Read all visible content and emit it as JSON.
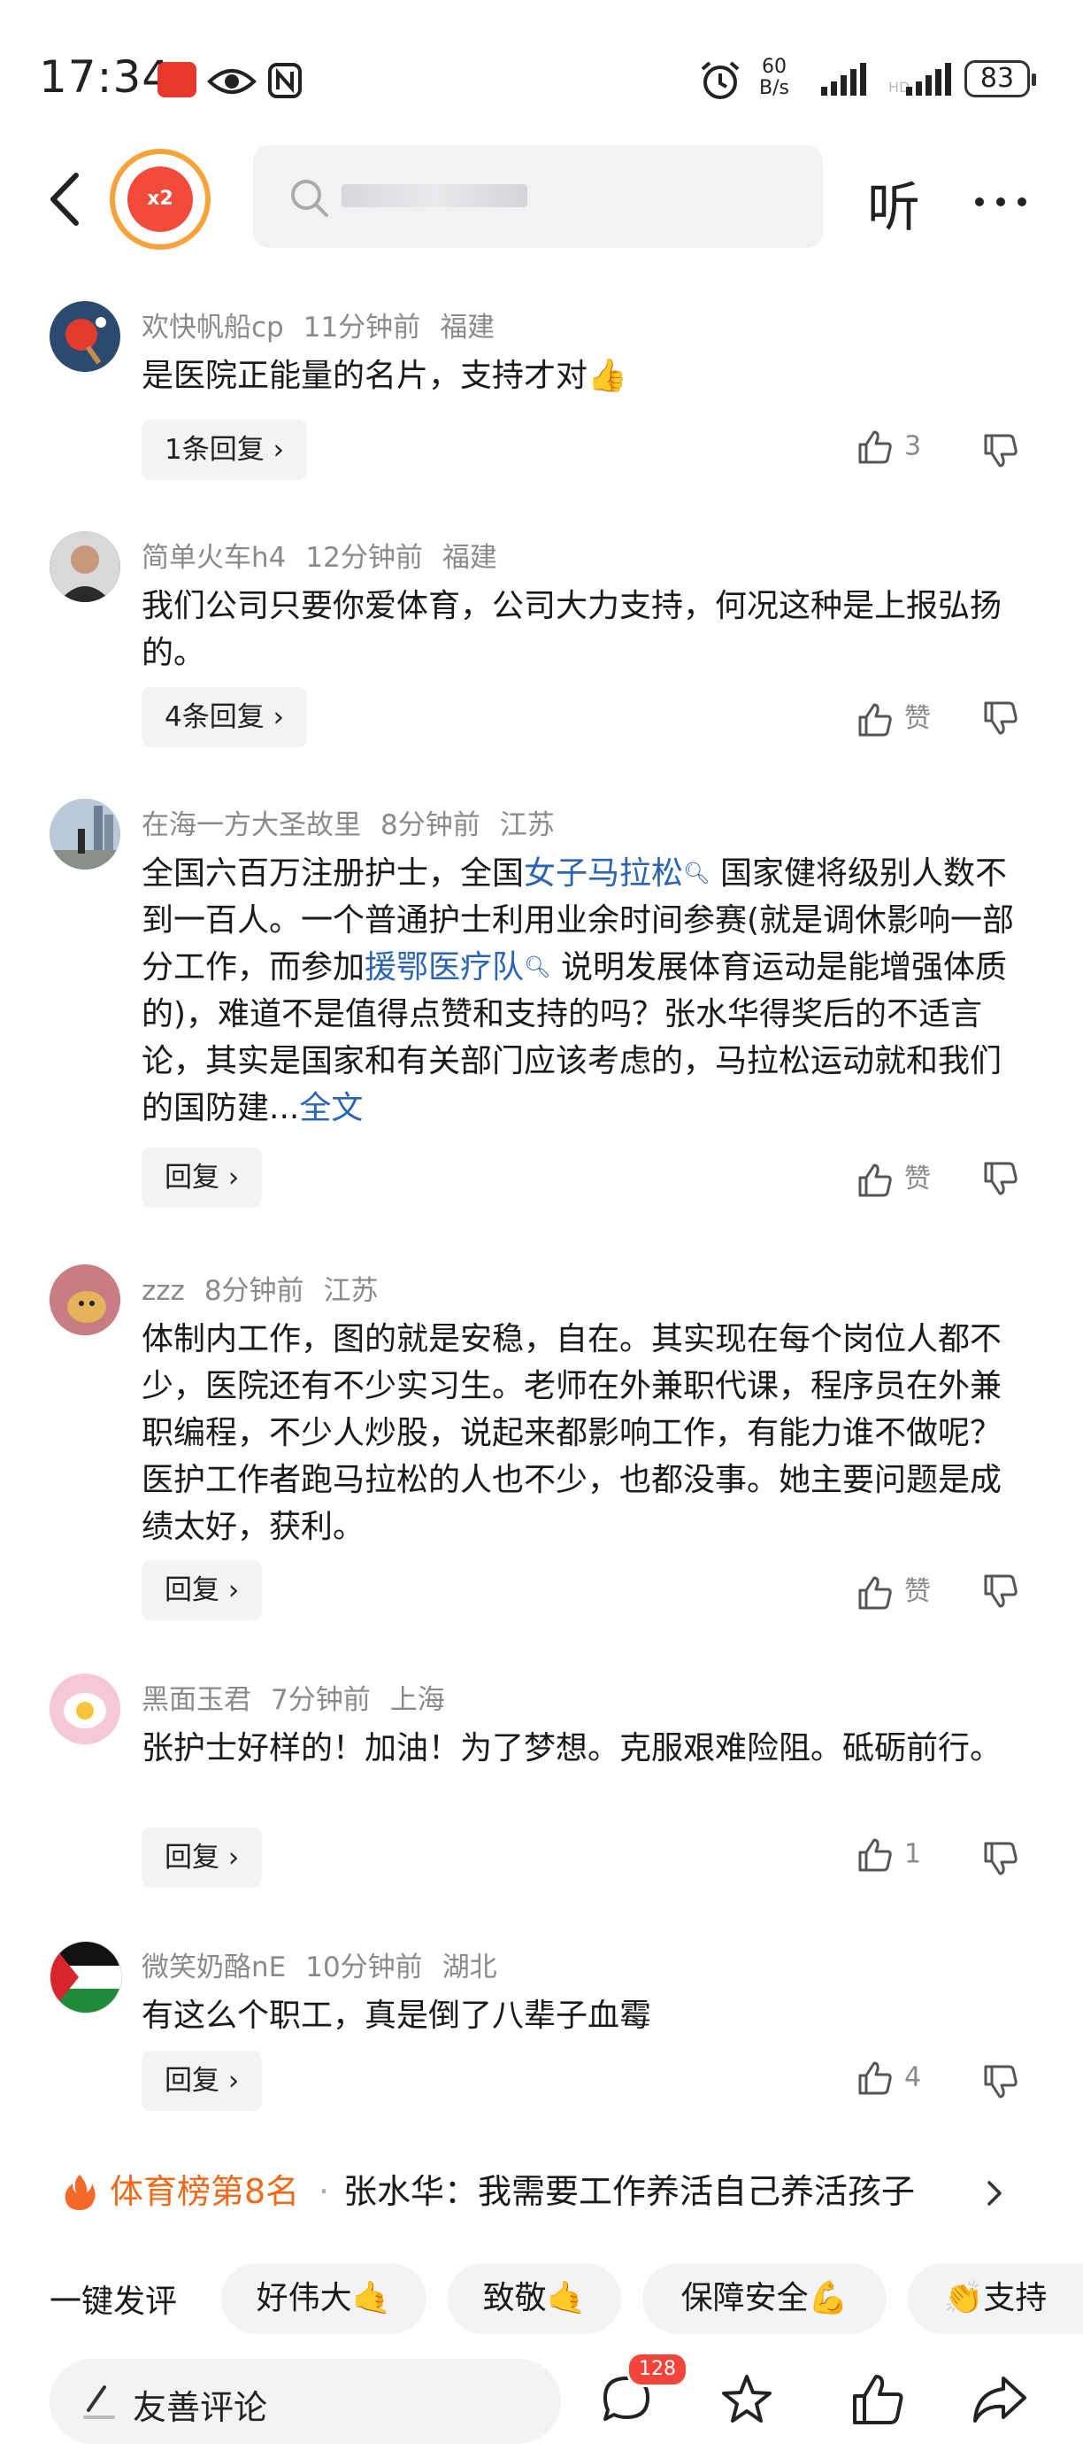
{
  "status_bar": {
    "time": "17:34",
    "network_speed_value": "60",
    "network_speed_unit": "B/s",
    "battery": "83",
    "icons": [
      "huawei-app-icon",
      "eye-icon",
      "nfc-icon",
      "alarm-icon",
      "signal-icon",
      "signal-icon"
    ]
  },
  "header": {
    "red_packet_label": "x2",
    "search_placeholder": "",
    "listen_label": "听",
    "icons": [
      "back-icon",
      "search-icon",
      "more-icon"
    ]
  },
  "comments": [
    {
      "user": "欢快帆船cp",
      "time": "11分钟前",
      "location": "福建",
      "text": "是医院正能量的名片，支持才对👍",
      "reply_label": "1条回复",
      "likes": "3"
    },
    {
      "user": "简单火车h4",
      "time": "12分钟前",
      "location": "福建",
      "text": "我们公司只要你爱体育，公司大力支持，何况这种是上报弘扬的。",
      "reply_label": "4条回复",
      "likes": "赞"
    },
    {
      "user": "在海一方大圣故里",
      "time": "8分钟前",
      "location": "江苏",
      "text_part1": "全国六百万注册护士，全国",
      "link1": "女子马拉松",
      "text_part2": " 国家健将级别人数不到一百人。一个普通护士利用业余时间参赛(就是调休影响一部分工作，而参加",
      "link2": "援鄂医疗队",
      "text_part3": " 说明发展体育运动是能增强体质的)，难道不是值得点赞和支持的吗？张水华得奖后的不适言论，其实是国家和有关部门应该考虑的，马拉松运动就和我们的国防建...",
      "more_label": "全文",
      "reply_label": "回复",
      "likes": "赞"
    },
    {
      "user": "zzz",
      "time": "8分钟前",
      "location": "江苏",
      "text": "体制内工作，图的就是安稳，自在。其实现在每个岗位人都不少，医院还有不少实习生。老师在外兼职代课，程序员在外兼职编程，不少人炒股，说起来都影响工作，有能力谁不做呢？医护工作者跑马拉松的人也不少，也都没事。她主要问题是成绩太好，获利。",
      "reply_label": "回复",
      "likes": "赞"
    },
    {
      "user": "黑面玉君",
      "time": "7分钟前",
      "location": "上海",
      "text": "张护士好样的！加油！为了梦想。克服艰难险阻。砥砺前行。",
      "reply_label": "回复",
      "likes": "1"
    },
    {
      "user": "微笑奶酪nE",
      "time": "10分钟前",
      "location": "湖北",
      "text": "有这么个职工，真是倒了八辈子血霉",
      "reply_label": "回复",
      "likes": "4"
    }
  ],
  "trending": {
    "rank_label": "体育榜第8名",
    "separator": "·",
    "title": "张水华：我需要工作养活自己养活孩子"
  },
  "quick_comment": {
    "label": "一键发评",
    "chips": [
      "好伟大🤙",
      "致敬🤙",
      "保障安全💪",
      "👏支持"
    ]
  },
  "bottom_bar": {
    "input_placeholder": "友善评论",
    "comment_badge": "128"
  },
  "colors": {
    "link": "#2a64b3",
    "trend_orange": "#ee6a1a",
    "badge_red": "#f2443a",
    "red_packet_ring": "#f7a23a"
  }
}
